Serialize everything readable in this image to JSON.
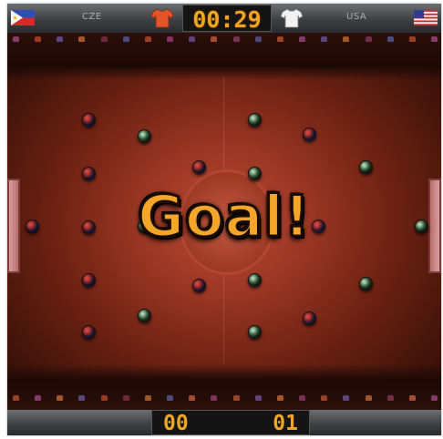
{
  "hud": {
    "timer": "00:29",
    "home_team": "CZE",
    "away_team": "USA",
    "home_flag": "philippines-flag-icon",
    "away_flag": "usa-flag-icon",
    "home_shirt_color": "#e2542a",
    "away_shirt_color": "#f2f2f2"
  },
  "event": {
    "message": "Goal!"
  },
  "score": {
    "home": "00",
    "away": "01"
  },
  "colors": {
    "accent": "#f0a420",
    "pitch": "#9a3624",
    "team_a": "#1d2b6a",
    "team_b": "#1d3322"
  }
}
